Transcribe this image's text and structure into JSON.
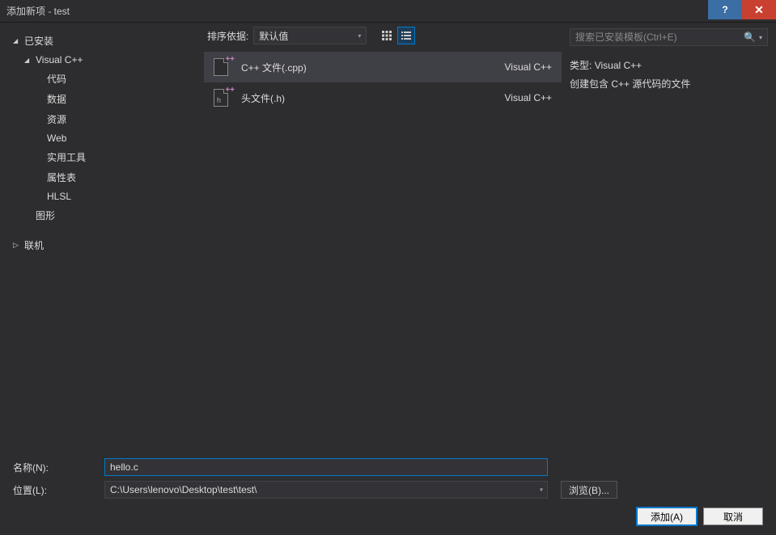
{
  "window": {
    "title": "添加新项 - test"
  },
  "sidebar": {
    "items": [
      {
        "label": "已安装",
        "level": 0,
        "expanded": true
      },
      {
        "label": "Visual C++",
        "level": 1,
        "expanded": true
      },
      {
        "label": "代码",
        "level": 2,
        "expanded": null
      },
      {
        "label": "数据",
        "level": 2,
        "expanded": null
      },
      {
        "label": "资源",
        "level": 2,
        "expanded": null
      },
      {
        "label": "Web",
        "level": 2,
        "expanded": null
      },
      {
        "label": "实用工具",
        "level": 2,
        "expanded": null
      },
      {
        "label": "属性表",
        "level": 2,
        "expanded": null
      },
      {
        "label": "HLSL",
        "level": 2,
        "expanded": null
      },
      {
        "label": "图形",
        "level": 1,
        "expanded": null,
        "noCaret": true
      },
      {
        "label": "联机",
        "level": 0,
        "expanded": false
      }
    ]
  },
  "center": {
    "sort_label": "排序依据:",
    "sort_value": "默认值",
    "templates": [
      {
        "name": "C++ 文件(.cpp)",
        "type": "Visual C++",
        "letter": "",
        "selected": true
      },
      {
        "name": "头文件(.h)",
        "type": "Visual C++",
        "letter": "h",
        "selected": false
      }
    ]
  },
  "right": {
    "search_placeholder": "搜索已安装模板(Ctrl+E)",
    "type_label": "类型:",
    "type_value": "Visual C++",
    "description": "创建包含 C++ 源代码的文件"
  },
  "form": {
    "name_label": "名称(N):",
    "name_value": "hello.c",
    "location_label": "位置(L):",
    "location_value": "C:\\Users\\lenovo\\Desktop\\test\\test\\",
    "browse_label": "浏览(B)..."
  },
  "buttons": {
    "add": "添加(A)",
    "cancel": "取消"
  }
}
